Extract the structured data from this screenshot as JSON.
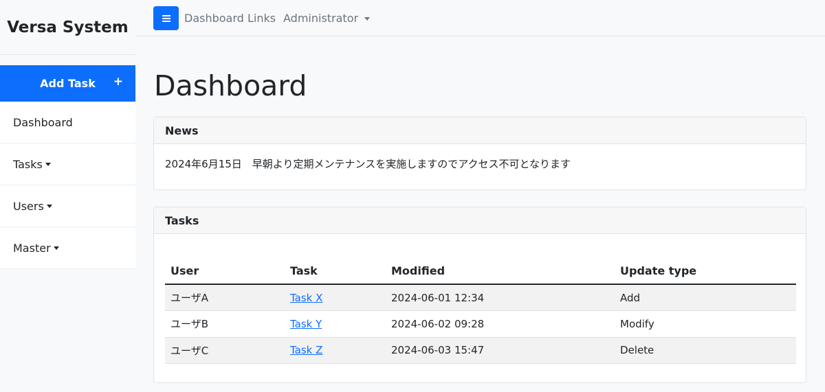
{
  "sidebar": {
    "brand": "Versa System",
    "add_task_label": "Add Task",
    "add_task_icon": "+",
    "items": [
      {
        "label": "Dashboard"
      },
      {
        "label": "Tasks"
      },
      {
        "label": "Users"
      },
      {
        "label": "Master"
      }
    ]
  },
  "topbar": {
    "menu_icon": "hamburger-icon",
    "links": [
      {
        "label": "Dashboard"
      },
      {
        "label": "Links"
      },
      {
        "label": "Administrator"
      }
    ]
  },
  "main": {
    "title": "Dashboard",
    "news": {
      "header": "News",
      "text": "2024年6月15日　早朝より定期メンテナンスを実施しますのでアクセス不可となります"
    },
    "tasks": {
      "header": "Tasks",
      "columns": [
        "User",
        "Task",
        "Modified",
        "Update type"
      ],
      "rows": [
        {
          "user": "ユーザA",
          "task": "Task X",
          "modified": "2024-06-01 12:34",
          "type": "Add"
        },
        {
          "user": "ユーザB",
          "task": "Task Y",
          "modified": "2024-06-02 09:28",
          "type": "Modify"
        },
        {
          "user": "ユーザC",
          "task": "Task Z",
          "modified": "2024-06-03 15:47",
          "type": "Delete"
        }
      ]
    }
  },
  "colors": {
    "primary": "#0d6efd",
    "muted_text": "#6c757d",
    "background": "#f8f9fa"
  }
}
